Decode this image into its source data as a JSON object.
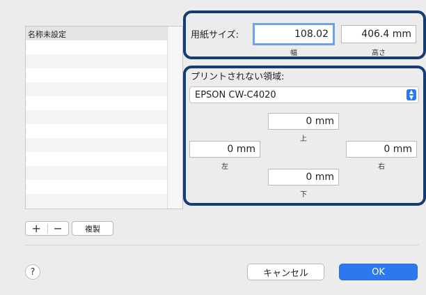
{
  "paper_list": {
    "items": [
      "名称未設定"
    ]
  },
  "list_controls": {
    "add": "+",
    "remove": "−",
    "duplicate": "複製"
  },
  "paper_size": {
    "label": "用紙サイズ:",
    "width_value": "108.02",
    "width_label": "幅",
    "height_value": "406.4 mm",
    "height_label": "高さ"
  },
  "non_printable": {
    "label": "プリントされない領域:",
    "printer": "EPSON CW-C4020",
    "top_value": "0 mm",
    "top_label": "上",
    "left_value": "0 mm",
    "left_label": "左",
    "right_value": "0 mm",
    "right_label": "右",
    "bottom_value": "0 mm",
    "bottom_label": "下"
  },
  "footer": {
    "help": "?",
    "cancel": "キャンセル",
    "ok": "OK"
  },
  "colors": {
    "highlight": "#163d73",
    "primary": "#2b78ef"
  }
}
